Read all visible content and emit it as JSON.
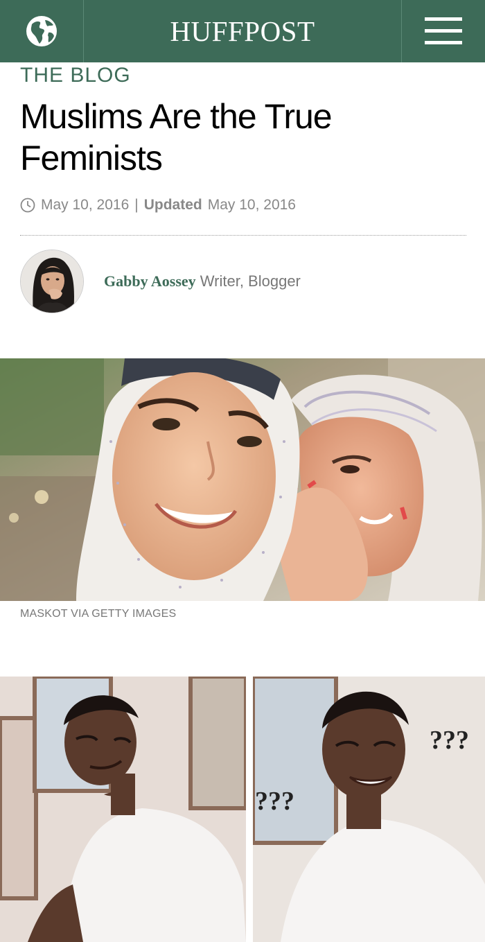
{
  "header": {
    "brand": "HUFFPOST",
    "globe_icon": "globe-icon",
    "menu_icon": "hamburger-menu-icon",
    "background_color": "#3d6b58"
  },
  "article": {
    "kicker": "THE BLOG",
    "headline": "Muslims Are the True Feminists",
    "date": "May 10, 2016",
    "separator": "|",
    "updated_label": "Updated",
    "updated_date": "May 10, 2016",
    "clock_icon": "clock-icon"
  },
  "author": {
    "name": "Gabby Aossey",
    "role": "Writer, Blogger"
  },
  "photo": {
    "caption": "MASKOT VIA GETTY IMAGES"
  },
  "meme": {
    "left_marks": "???",
    "right_marks": "???"
  }
}
